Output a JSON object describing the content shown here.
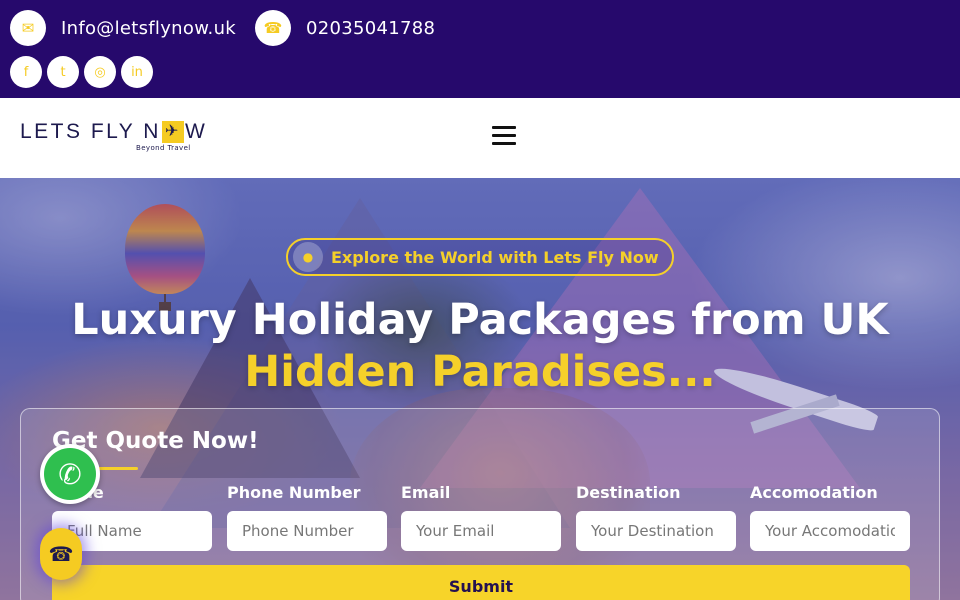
{
  "topbar": {
    "email": "Info@letsflynow.uk",
    "email_icon": "envelope-icon",
    "phone": "02035041788",
    "phone_icon": "phone-icon",
    "socials": [
      "facebook-icon",
      "twitter-icon",
      "instagram-icon",
      "linkedin-icon"
    ]
  },
  "navbar": {
    "logo_text_before": "LETS FLY N",
    "logo_text_after": "W",
    "logo_tagline": "Beyond Travel",
    "menu_icon": "hamburger-menu-icon"
  },
  "hero": {
    "badge_text": "Explore the World with Lets Fly Now",
    "title": "Luxury Holiday Packages from UK",
    "subtitle": "Hidden Paradises..."
  },
  "quote_form": {
    "title": "Get Quote Now!",
    "fields": [
      {
        "label": "Name",
        "placeholder": "Full Name"
      },
      {
        "label": "Phone Number",
        "placeholder": "Phone Number"
      },
      {
        "label": "Email",
        "placeholder": "Your Email"
      },
      {
        "label": "Destination",
        "placeholder": "Your Destination"
      },
      {
        "label": "Accomodation",
        "placeholder": "Your Accomodation"
      }
    ],
    "submit_label": "Submit"
  },
  "colors": {
    "topbar_bg": "#26096c",
    "accent_yellow": "#f5d02a",
    "whatsapp_green": "#2fbf4f"
  }
}
